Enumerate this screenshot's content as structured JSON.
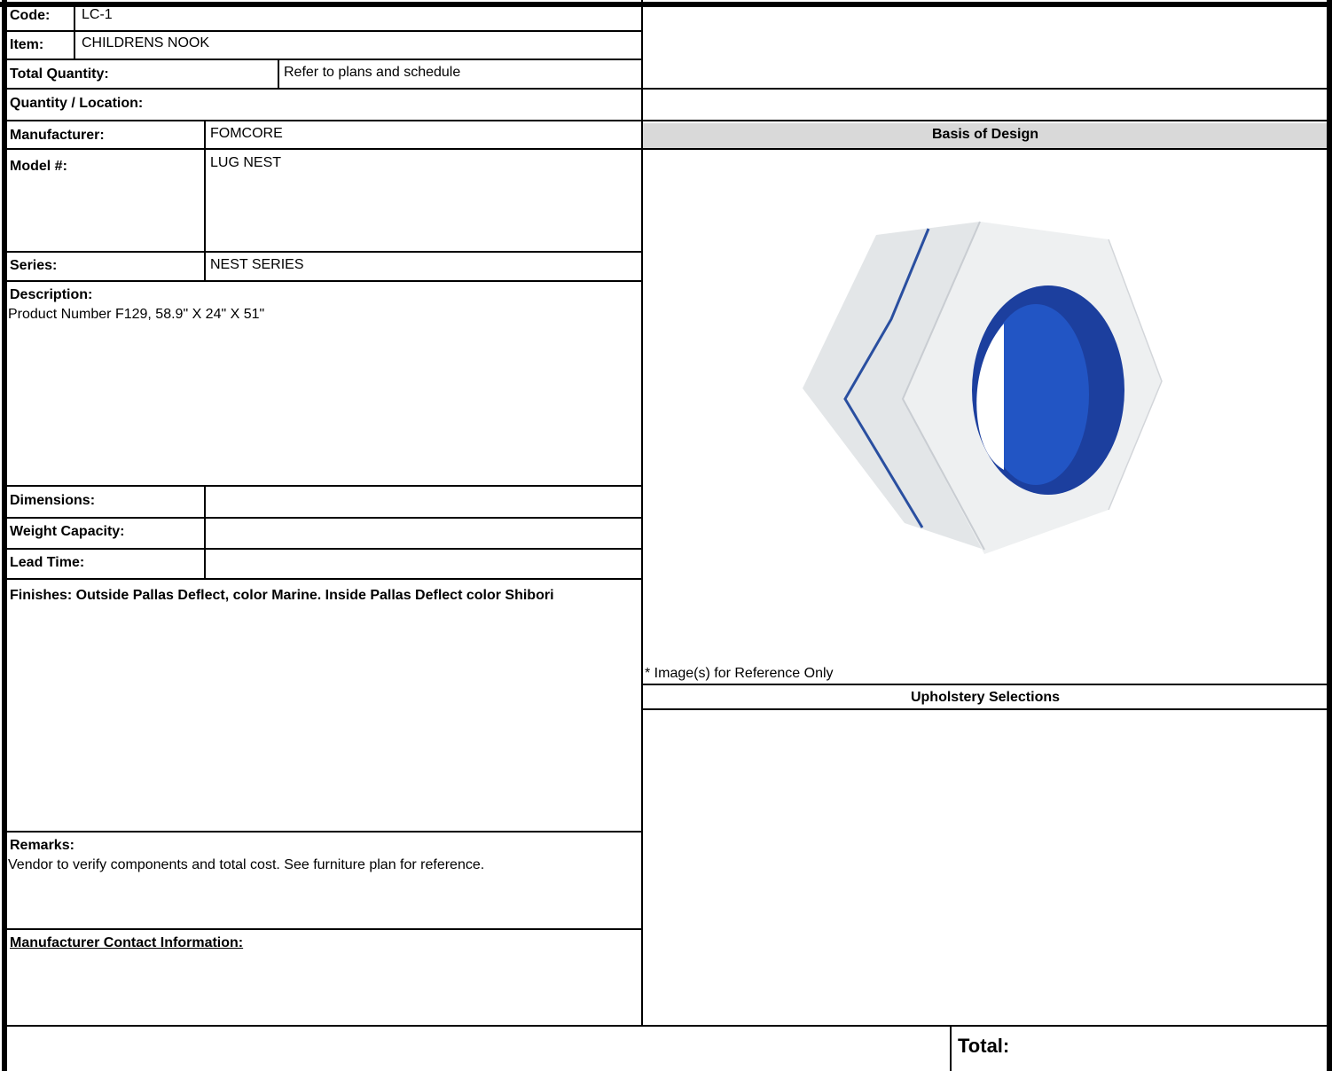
{
  "header": {
    "code_label": "Code:",
    "code_value": "LC-1",
    "item_label": "Item:",
    "item_value": "CHILDRENS NOOK",
    "total_quantity_label": "Total Quantity:",
    "total_quantity_value": "Refer to plans and schedule",
    "quantity_location_label": "Quantity / Location:"
  },
  "specs": {
    "manufacturer_label": "Manufacturer:",
    "manufacturer_value": "FOMCORE",
    "model_label": "Model #:",
    "model_value": "LUG NEST",
    "series_label": "Series:",
    "series_value": "NEST SERIES",
    "description_label": "Description:",
    "description_value": "Product Number F129, 58.9\" X 24\" X 51\"",
    "dimensions_label": "Dimensions:",
    "dimensions_value": "",
    "weight_capacity_label": "Weight Capacity:",
    "weight_capacity_value": "",
    "lead_time_label": "Lead Time:",
    "lead_time_value": "",
    "finishes_text": "Finishes: Outside Pallas Deflect, color Marine. Inside Pallas Deflect color Shibori",
    "remarks_label": "Remarks:",
    "remarks_value": "Vendor to verify components and total cost. See furniture plan for reference.",
    "contact_label": "Manufacturer Contact Information:"
  },
  "right_panel": {
    "basis_of_design_label": "Basis of Design",
    "image_note": "* Image(s) for Reference Only",
    "upholstery_label": "Upholstery Selections",
    "product_image_icon": "hexagonal-nook-image",
    "colors": {
      "header_fill": "#d9d9d9",
      "inner_blue": "#1f4fb0",
      "seam_blue": "#2a4fa0"
    }
  },
  "footer": {
    "total_label": "Total:"
  }
}
